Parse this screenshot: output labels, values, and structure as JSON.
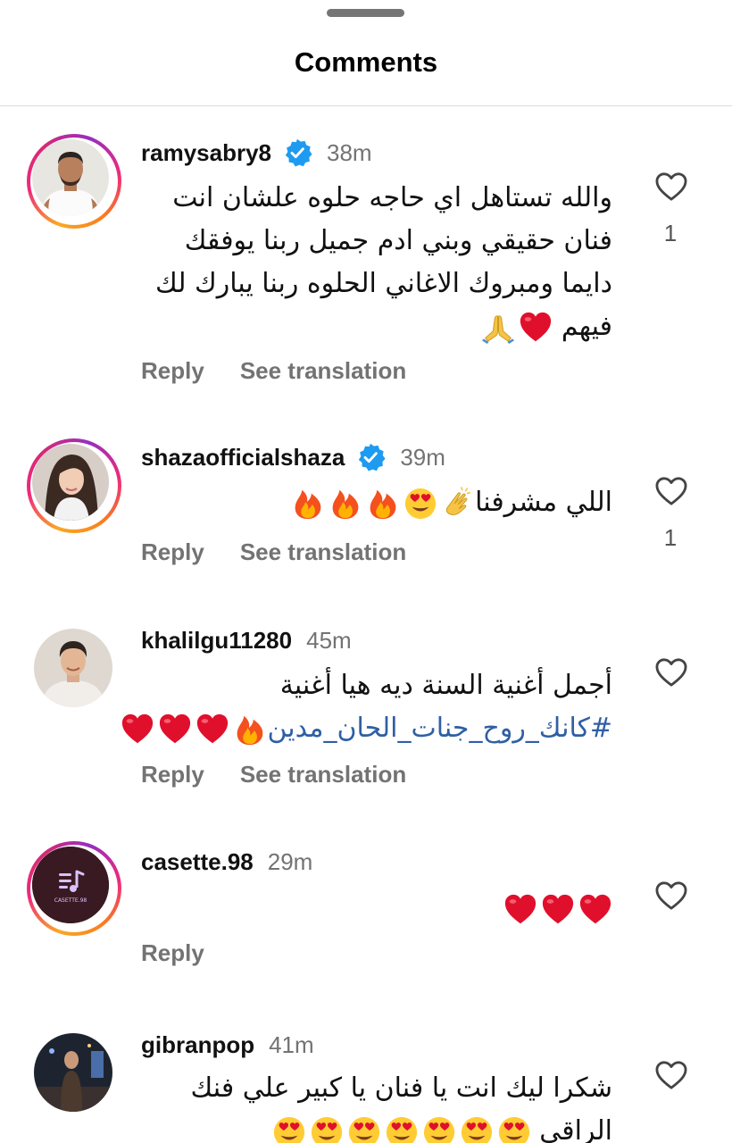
{
  "header": {
    "title": "Comments"
  },
  "comments": [
    {
      "username": "ramysabry8",
      "verified": true,
      "time": "38m",
      "lines": [
        "والله تستاهل اي حاجه حلوه علشان انت",
        "فنان حقيقي وبني ادم جميل ربنا يوفقك",
        "دايما ومبروك الاغاني الحلوه ربنا يبارك لك",
        "فيهم"
      ],
      "emojis": [
        "red-heart",
        "folded-hands"
      ],
      "reply_label": "Reply",
      "translate_label": "See translation",
      "likes": "1"
    },
    {
      "username": "shazaofficialshaza",
      "verified": true,
      "time": "39m",
      "lines": [
        "اللي مشرفنا"
      ],
      "emojis": [
        "clapping-hands",
        "heart-eyes-face",
        "fire",
        "fire",
        "fire"
      ],
      "reply_label": "Reply",
      "translate_label": "See translation",
      "likes": "1"
    },
    {
      "username": "khalilgu11280",
      "verified": false,
      "time": "45m",
      "lines": [
        "أجمل أغنية السنة ديه هيا أغنية",
        "#كانك_روح_جنات_الحان_مدين"
      ],
      "emojis": [
        "fire",
        "red-heart",
        "red-heart",
        "red-heart"
      ],
      "reply_label": "Reply",
      "translate_label": "See translation",
      "likes": ""
    },
    {
      "username": "casette.98",
      "verified": false,
      "time": "29m",
      "lines": [],
      "emojis": [
        "red-heart",
        "red-heart",
        "red-heart"
      ],
      "avatar_text": "CASETTE.98",
      "reply_label": "Reply",
      "translate_label": "",
      "likes": ""
    },
    {
      "username": "gibranpop",
      "verified": false,
      "time": "41m",
      "lines": [
        "شكرا ليك انت يا فنان يا كبير علي فنك",
        "الراقي"
      ],
      "emojis": [
        "heart-eyes-face",
        "heart-eyes-face",
        "heart-eyes-face",
        "heart-eyes-face",
        "heart-eyes-face",
        "heart-eyes-face",
        "heart-eyes-face",
        "heart-eyes-face"
      ],
      "reply_label": "",
      "translate_label": "",
      "likes": ""
    }
  ],
  "icons": {
    "like": "heart-outline-icon",
    "verified": "verified-badge-icon"
  },
  "colors": {
    "verified": "#1d9bf0",
    "meta_text": "#737373",
    "hashtag": "#2f5fa4",
    "heart": "#e0102c"
  }
}
